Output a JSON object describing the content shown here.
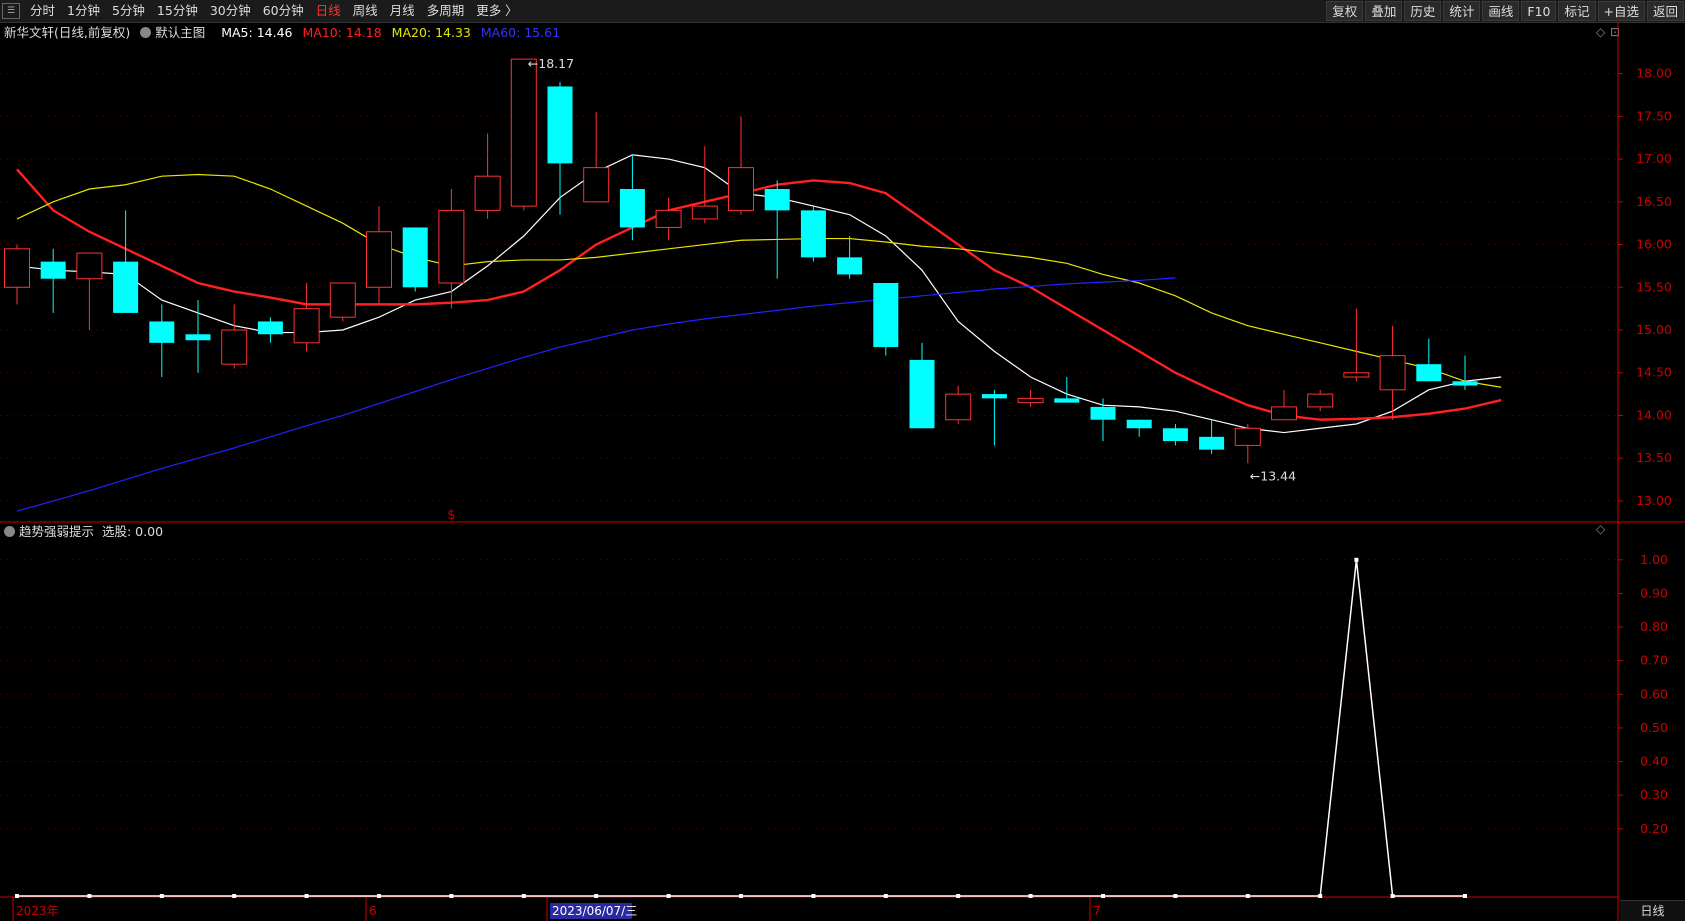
{
  "toolbar": {
    "menu_icon": "menu-icon",
    "periods": [
      "分时",
      "1分钟",
      "5分钟",
      "15分钟",
      "30分钟",
      "60分钟",
      "日线",
      "周线",
      "月线",
      "多周期",
      "更多 〉"
    ],
    "active_period": "日线",
    "right_buttons": [
      "复权",
      "叠加",
      "历史",
      "统计",
      "画线",
      "F10",
      "标记",
      "+自选",
      "返回"
    ]
  },
  "legend": {
    "stock_name": "新华文轩(日线,前复权)",
    "template": "默认主图",
    "ma5": "MA5: 14.46",
    "ma10": "MA10: 14.18",
    "ma20": "MA20: 14.33",
    "ma60": "MA60: 15.61"
  },
  "legend2": {
    "indicator": "趋势强弱提示",
    "value": "选股: 0.00"
  },
  "colors": {
    "up": "#ff3333",
    "down": "#00ffff",
    "ma5": "#ffffff",
    "ma10": "#ff2020",
    "ma20": "#e6e600",
    "ma60": "#2222ff",
    "axis": "#cc0000",
    "grid": "#3a0000",
    "indicator": "#ffffff"
  },
  "period_label": "日线",
  "chart_data": [
    {
      "type": "candlestick",
      "ylim": [
        12.8,
        18.3
      ],
      "y_ticks": [
        "18.00",
        "17.50",
        "17.00",
        "16.50",
        "16.00",
        "15.50",
        "15.00",
        "14.50",
        "14.00",
        "13.50",
        "13.00"
      ],
      "y_tick_values": [
        18.0,
        17.5,
        17.0,
        16.5,
        16.0,
        15.5,
        15.0,
        14.5,
        14.0,
        13.5,
        13.0
      ],
      "x_labels": [
        "2023年",
        "6",
        "2023/06/07/三",
        "7"
      ],
      "x_label_index": [
        0,
        10,
        15,
        30
      ],
      "annotations": {
        "high": "18.17",
        "high_index": 14,
        "low": "13.44",
        "low_index": 34,
        "marker": "$",
        "marker_index": 12
      },
      "candles": [
        {
          "o": 15.5,
          "h": 16.0,
          "l": 15.3,
          "c": 15.95
        },
        {
          "o": 15.8,
          "h": 15.95,
          "l": 15.2,
          "c": 15.6
        },
        {
          "o": 15.6,
          "h": 15.9,
          "l": 15.0,
          "c": 15.9
        },
        {
          "o": 15.8,
          "h": 16.4,
          "l": 15.2,
          "c": 15.2
        },
        {
          "o": 15.1,
          "h": 15.3,
          "l": 14.45,
          "c": 14.85
        },
        {
          "o": 14.95,
          "h": 15.35,
          "l": 14.5,
          "c": 14.88
        },
        {
          "o": 14.6,
          "h": 15.3,
          "l": 14.55,
          "c": 15.0
        },
        {
          "o": 15.1,
          "h": 15.15,
          "l": 14.85,
          "c": 14.95
        },
        {
          "o": 14.85,
          "h": 15.55,
          "l": 14.75,
          "c": 15.25
        },
        {
          "o": 15.15,
          "h": 15.55,
          "l": 15.1,
          "c": 15.55
        },
        {
          "o": 15.5,
          "h": 16.45,
          "l": 15.3,
          "c": 16.15
        },
        {
          "o": 16.2,
          "h": 16.2,
          "l": 15.45,
          "c": 15.5
        },
        {
          "o": 15.55,
          "h": 16.65,
          "l": 15.25,
          "c": 16.4
        },
        {
          "o": 16.4,
          "h": 17.3,
          "l": 16.3,
          "c": 16.8
        },
        {
          "o": 16.45,
          "h": 18.17,
          "l": 16.4,
          "c": 18.17
        },
        {
          "o": 17.85,
          "h": 17.9,
          "l": 16.35,
          "c": 16.95
        },
        {
          "o": 16.5,
          "h": 17.55,
          "l": 16.5,
          "c": 16.9
        },
        {
          "o": 16.65,
          "h": 17.05,
          "l": 16.05,
          "c": 16.2
        },
        {
          "o": 16.2,
          "h": 16.55,
          "l": 16.05,
          "c": 16.4
        },
        {
          "o": 16.3,
          "h": 17.15,
          "l": 16.25,
          "c": 16.45
        },
        {
          "o": 16.4,
          "h": 17.5,
          "l": 16.35,
          "c": 16.9
        },
        {
          "o": 16.65,
          "h": 16.75,
          "l": 15.6,
          "c": 16.4
        },
        {
          "o": 16.4,
          "h": 16.45,
          "l": 15.8,
          "c": 15.85
        },
        {
          "o": 15.85,
          "h": 16.1,
          "l": 15.6,
          "c": 15.65
        },
        {
          "o": 15.55,
          "h": 15.55,
          "l": 14.7,
          "c": 14.8
        },
        {
          "o": 14.65,
          "h": 14.85,
          "l": 13.85,
          "c": 13.85
        },
        {
          "o": 13.95,
          "h": 14.35,
          "l": 13.9,
          "c": 14.25
        },
        {
          "o": 14.25,
          "h": 14.3,
          "l": 13.65,
          "c": 14.2
        },
        {
          "o": 14.15,
          "h": 14.3,
          "l": 14.1,
          "c": 14.2
        },
        {
          "o": 14.2,
          "h": 14.45,
          "l": 14.15,
          "c": 14.15
        },
        {
          "o": 14.1,
          "h": 14.2,
          "l": 13.7,
          "c": 13.95
        },
        {
          "o": 13.95,
          "h": 13.95,
          "l": 13.75,
          "c": 13.85
        },
        {
          "o": 13.85,
          "h": 13.9,
          "l": 13.65,
          "c": 13.7
        },
        {
          "o": 13.75,
          "h": 13.95,
          "l": 13.55,
          "c": 13.6
        },
        {
          "o": 13.65,
          "h": 13.9,
          "l": 13.44,
          "c": 13.85
        },
        {
          "o": 13.95,
          "h": 14.3,
          "l": 13.95,
          "c": 14.1
        },
        {
          "o": 14.1,
          "h": 14.3,
          "l": 14.05,
          "c": 14.25
        },
        {
          "o": 14.45,
          "h": 15.25,
          "l": 14.4,
          "c": 14.5
        },
        {
          "o": 14.3,
          "h": 15.05,
          "l": 13.95,
          "c": 14.7
        },
        {
          "o": 14.6,
          "h": 14.9,
          "l": 14.4,
          "c": 14.4
        },
        {
          "o": 14.4,
          "h": 14.7,
          "l": 14.3,
          "c": 14.35
        }
      ],
      "series": [
        {
          "name": "MA5",
          "values": [
            15.75,
            15.7,
            15.68,
            15.65,
            15.35,
            15.2,
            15.05,
            14.97,
            14.97,
            15.0,
            15.15,
            15.35,
            15.45,
            15.75,
            16.1,
            16.55,
            16.85,
            17.05,
            17.0,
            16.9,
            16.6,
            16.55,
            16.45,
            16.35,
            16.1,
            15.7,
            15.1,
            14.75,
            14.45,
            14.25,
            14.12,
            14.1,
            14.05,
            13.95,
            13.85,
            13.8,
            13.85,
            13.9,
            14.05,
            14.3,
            14.4,
            14.45
          ]
        },
        {
          "name": "MA10",
          "values": [
            16.88,
            16.4,
            16.15,
            15.95,
            15.75,
            15.55,
            15.45,
            15.38,
            15.3,
            15.3,
            15.3,
            15.3,
            15.32,
            15.35,
            15.45,
            15.7,
            16.0,
            16.2,
            16.4,
            16.5,
            16.6,
            16.7,
            16.75,
            16.72,
            16.6,
            16.3,
            16.0,
            15.7,
            15.5,
            15.25,
            15.0,
            14.75,
            14.5,
            14.3,
            14.12,
            14.0,
            13.95,
            13.96,
            13.98,
            14.02,
            14.08,
            14.18
          ]
        },
        {
          "name": "MA20",
          "values": [
            16.3,
            16.5,
            16.65,
            16.7,
            16.8,
            16.82,
            16.8,
            16.65,
            16.45,
            16.25,
            16.0,
            15.85,
            15.75,
            15.8,
            15.82,
            15.82,
            15.85,
            15.9,
            15.95,
            16.0,
            16.05,
            16.06,
            16.07,
            16.07,
            16.03,
            15.98,
            15.95,
            15.9,
            15.85,
            15.78,
            15.65,
            15.55,
            15.4,
            15.2,
            15.05,
            14.95,
            14.85,
            14.75,
            14.65,
            14.55,
            14.4,
            14.33
          ]
        },
        {
          "name": "MA60",
          "values": [
            12.88,
            13.0,
            13.12,
            13.25,
            13.38,
            13.5,
            13.62,
            13.75,
            13.88,
            14.0,
            14.14,
            14.28,
            14.42,
            14.55,
            14.68,
            14.8,
            14.9,
            15.0,
            15.07,
            15.13,
            15.18,
            15.23,
            15.28,
            15.32,
            15.36,
            15.4,
            15.44,
            15.48,
            15.51,
            15.54,
            15.56,
            15.58,
            15.61
          ]
        }
      ]
    },
    {
      "type": "line",
      "name": "趋势强弱提示",
      "ylim": [
        0,
        1.05
      ],
      "y_ticks": [
        "1.00",
        "0.90",
        "0.80",
        "0.70",
        "0.60",
        "0.50",
        "0.40",
        "0.30",
        "0.20"
      ],
      "y_tick_values": [
        1.0,
        0.9,
        0.8,
        0.7,
        0.6,
        0.5,
        0.4,
        0.3,
        0.2
      ],
      "values": [
        0,
        0,
        0,
        0,
        0,
        0,
        0,
        0,
        0,
        0,
        0,
        0,
        0,
        0,
        0,
        0,
        0,
        0,
        0,
        0,
        0,
        0,
        0,
        0,
        0,
        0,
        0,
        0,
        0,
        0,
        0,
        0,
        0,
        0,
        0,
        0,
        0,
        1,
        0,
        0,
        0
      ]
    }
  ]
}
